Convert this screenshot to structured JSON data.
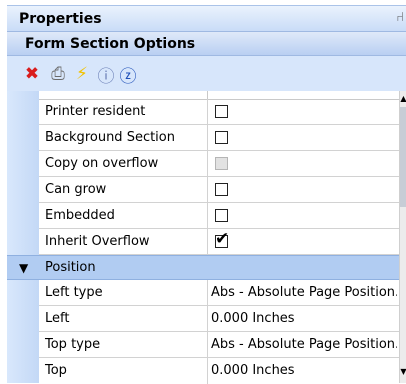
{
  "panel": {
    "title": "Properties",
    "pin_glyph": "⑁",
    "subheader": "Form Section Options"
  },
  "toolbar": {
    "buttons": [
      {
        "name": "delete-icon",
        "glyph": "✖",
        "color": "#d91d1d"
      },
      {
        "name": "print-icon",
        "glyph": "⎙",
        "color": "#6a6a6a"
      },
      {
        "name": "lightning-icon",
        "glyph": "⚡",
        "color": "#f2c200"
      },
      {
        "name": "info-icon",
        "glyph": "ⓘ",
        "color": "#6b7fb6"
      },
      {
        "name": "help-icon",
        "glyph": "ⓩ",
        "color": "#1e4fb8"
      }
    ]
  },
  "properties": [
    {
      "label": "Printer resident",
      "type": "checkbox",
      "checked": false,
      "enabled": true
    },
    {
      "label": "Background Section",
      "type": "checkbox",
      "checked": false,
      "enabled": true
    },
    {
      "label": "Copy on overflow",
      "type": "checkbox",
      "checked": false,
      "enabled": false
    },
    {
      "label": "Can grow",
      "type": "checkbox",
      "checked": false,
      "enabled": true
    },
    {
      "label": "Embedded",
      "type": "checkbox",
      "checked": false,
      "enabled": true
    },
    {
      "label": "Inherit Overflow",
      "type": "checkbox",
      "checked": true,
      "enabled": true
    }
  ],
  "position_section": {
    "label": "Position",
    "expand_glyph": "▼"
  },
  "position_properties": [
    {
      "label": "Left type",
      "value": "Abs - Absolute Page Position."
    },
    {
      "label": "Left",
      "value": "0.000 Inches"
    },
    {
      "label": "Top type",
      "value": "Abs - Absolute Page Position."
    },
    {
      "label": "Top",
      "value": "0.000 Inches"
    }
  ],
  "checkmark_glyph": "✔",
  "scrollbar": {
    "up_glyph": "▲",
    "down_glyph": "▼"
  },
  "colors": {
    "title_bg": "#c9dcf7",
    "section_bg": "#b1ccf2",
    "toolbar_bg": "#d7e6fb"
  }
}
